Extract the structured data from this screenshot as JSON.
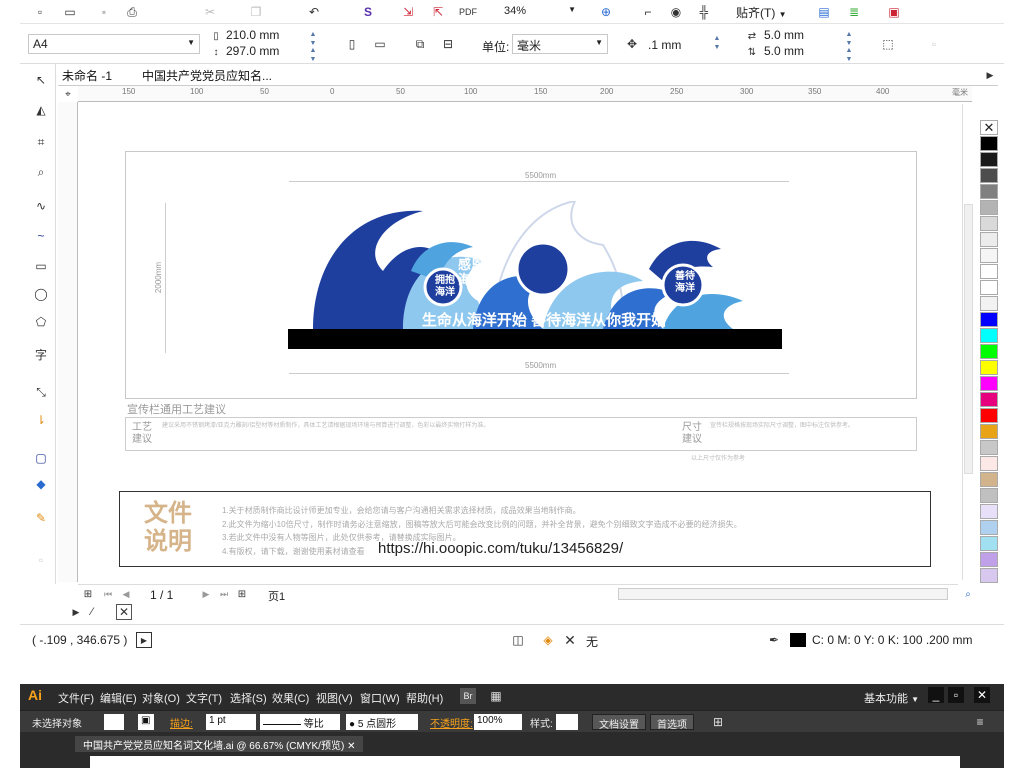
{
  "toolbar": {
    "zoom": "34%",
    "snap_label": "贴齐(T)",
    "page_size": "A4",
    "width": "210.0 mm",
    "height": "297.0 mm",
    "units_label": "单位:",
    "units_value": "毫米",
    "nudge": ".1 mm",
    "dup_x": "5.0 mm",
    "dup_y": "5.0 mm"
  },
  "tabs": [
    "未命名 -1",
    "中国共产党党员应知名..."
  ],
  "ruler_ticks": [
    "150",
    "100",
    "50",
    "0",
    "50",
    "100",
    "150",
    "200",
    "250",
    "300",
    "350",
    "400",
    "450",
    "500",
    "550",
    "600",
    "毫米"
  ],
  "design": {
    "width_dim": "5500mm",
    "height_dim": "2000mm",
    "bottom_dim": "5500mm",
    "badge_left": [
      "拥抱",
      "海洋"
    ],
    "badge_center": [
      "感恩",
      "海洋"
    ],
    "badge_right": [
      "善待",
      "海洋"
    ],
    "slogan": "生命从海洋开始 善待海洋从你我开始",
    "craft_title": "宣传栏通用工艺建议",
    "craft_label": [
      "工艺",
      "建议"
    ],
    "size_label": [
      "尺寸",
      "建议"
    ],
    "craft_text": "建议采用不锈钢烤漆/亚克力雕刻/铝型材等材质制作，具体工艺请根据现场环境与预算进行调整，色彩以最终实物打样为准。",
    "size_text": "宣传栏规格按现场实际尺寸调整，图中标注仅供参考。",
    "footer_note": "以上尺寸仅作为参考"
  },
  "notice": {
    "title": [
      "文件",
      "说明"
    ],
    "lines": [
      "1.关于材质制作商比设计师更加专业，会给您请与客户沟通相关需求选择材质，成品效果当地制作商。",
      "2.此文件为缩小10倍尺寸，制作时请务必注意缩放，图稿等放大后可能会改变比例的问题，并补全背景，避免个别细致文字造成不必要的经济损失。",
      "3.若此文件中没有人物等图片，此处仅供参考，请替换成实际图片。",
      "4.有版权，请下载，谢谢使用素材请查看"
    ],
    "url": "https://hi.ooopic.com/tuku/13456829/"
  },
  "pager": {
    "page": "1 / 1",
    "page_tab": "页1"
  },
  "status": {
    "coords": "( -.109 , 346.675 )",
    "fill_none": "无",
    "outline": "C: 0 M: 0 Y: 0 K: 100  .200 mm"
  },
  "palette": [
    "#ffffff",
    "#000000",
    "#1a1a1a",
    "#4d4d4d",
    "#808080",
    "#b3b3b3",
    "#d9d9d9",
    "#ececec",
    "#f5f5f5",
    "#ffffff",
    "#ffffff",
    "#f2f2f2",
    "#0000ff",
    "#00ffff",
    "#00ff00",
    "#ffff00",
    "#ff00ff",
    "#e6007e",
    "#ff0000",
    "#e8a317",
    "#c8c8c8",
    "#fde8e8",
    "#d2b48c",
    "#c0c0c0",
    "#e8e0f8",
    "#b0d0f0",
    "#a0e0f0",
    "#c0a0e8",
    "#d8c8f0"
  ],
  "colors": {
    "deep_blue": "#1f3f9e",
    "mid_blue": "#2f6fd0",
    "light_blue": "#8fc8ef",
    "notice_text": "#c8a57a"
  },
  "ai": {
    "logo": "Ai",
    "menus": [
      "文件(F)",
      "编辑(E)",
      "对象(O)",
      "文字(T)",
      "选择(S)",
      "效果(C)",
      "视图(V)",
      "窗口(W)",
      "帮助(H)"
    ],
    "workspace": "基本功能",
    "no_selection": "未选择对象",
    "stroke_label": "描边:",
    "stroke_value": "1 pt",
    "stroke_style": "等比",
    "brush": "5 点圆形",
    "opacity_label": "不透明度:",
    "opacity_value": "100%",
    "style_label": "样式:",
    "doc_setup": "文档设置",
    "prefs": "首选项",
    "doc_tab": "中国共产党党员应知名词文化墙.ai @ 66.67% (CMYK/预览)"
  }
}
